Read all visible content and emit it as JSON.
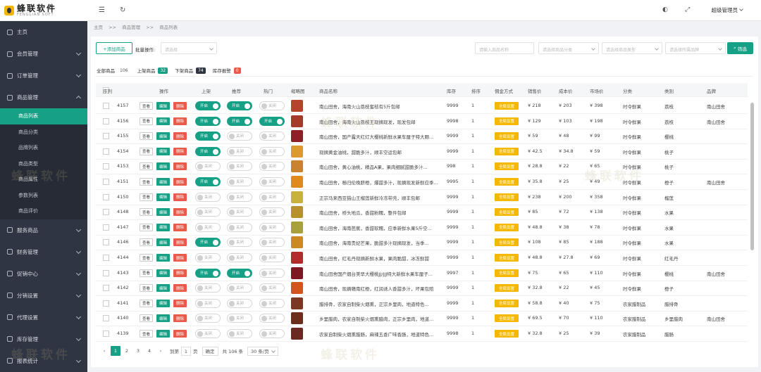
{
  "logo": {
    "cn": "蜂联软件",
    "en": "FENGLIAN SOFT"
  },
  "sidebar": {
    "groups": [
      {
        "label": "主页"
      },
      {
        "label": "会员管理"
      },
      {
        "label": "订单管理"
      },
      {
        "label": "商品管理"
      },
      {
        "label": "服务商品"
      },
      {
        "label": "财务管理"
      },
      {
        "label": "促销中心"
      },
      {
        "label": "分销设置"
      },
      {
        "label": "代理设置"
      },
      {
        "label": "库存管理"
      },
      {
        "label": "报表统计"
      }
    ],
    "sub": [
      "商品列表",
      "商品分类",
      "品牌列表",
      "商品类型",
      "商品属性",
      "参数列表",
      "商品评价"
    ]
  },
  "topbar": {
    "menu_icon": "menu-icon",
    "refresh_icon": "refresh-icon",
    "user": "超级管理员"
  },
  "breadcrumb": [
    "主页",
    ">>",
    "商品管理",
    ">>",
    "商品列表"
  ],
  "toolbar": {
    "add": "+添加商品",
    "bulk_label": "批量操作:",
    "bulk_placeholder": "请选择",
    "search_placeholder": "请输入商品名称",
    "category_placeholder": "请选择商品分类",
    "type_placeholder": "请选择商品类型",
    "brand_placeholder": "请选择所属品牌",
    "filter": "筛选"
  },
  "tabs": [
    {
      "label": "全部商品",
      "count": "106",
      "color": "none"
    },
    {
      "label": "上架商品",
      "count": "32",
      "color": "#16a085"
    },
    {
      "label": "下架商品",
      "count": "74",
      "color": "#2f3542"
    },
    {
      "label": "库存报警",
      "count": "0",
      "color": "#ea5a4b"
    }
  ],
  "columns": [
    "序列",
    "操作",
    "上架",
    "推荐",
    "热门",
    "缩略图",
    "商品名称",
    "库存",
    "排序",
    "佣金方式",
    "销售价",
    "成本价",
    "市场价",
    "分类",
    "类别",
    "品牌"
  ],
  "ops": {
    "view": "查看",
    "edit": "编辑",
    "del": "删除"
  },
  "switch": {
    "on": "开启",
    "off": "关闭"
  },
  "commission_tag": "全局设置",
  "colors": {
    "accent": "#16a085",
    "danger": "#ea5a4b",
    "warning": "#f5b800",
    "sidebar": "#2f3542"
  },
  "rows": [
    {
      "id": "4157",
      "up": true,
      "rec": true,
      "hot": false,
      "name": "南山田舍，海南火山荔枝蜜桔有5斤包邮",
      "stock": "9999",
      "sort": "1",
      "price": "¥ 218",
      "cost": "¥ 203",
      "market": "¥ 398",
      "cat": "时令鲜果",
      "kind": "荔枝",
      "brand": "南山田舍",
      "thumb": "#b5442c"
    },
    {
      "id": "4156",
      "up": true,
      "rec": true,
      "hot": true,
      "name": "南山田舍，海南火山荔枝王现摘现发，现发包邮",
      "stock": "9998",
      "sort": "1",
      "price": "¥ 129",
      "cost": "¥ 103",
      "market": "¥ 198",
      "cat": "时令鲜果",
      "kind": "荔枝",
      "brand": "南山田舍",
      "thumb": "#a63a2a"
    },
    {
      "id": "4155",
      "up": true,
      "rec": false,
      "hot": false,
      "name": "南山田舍，国产露天红灯大樱桃新鲜水果车厘子特大颗...",
      "stock": "9999",
      "sort": "1",
      "price": "¥ 59",
      "cost": "¥ 48",
      "market": "¥ 99",
      "cat": "时令鲜果",
      "kind": "樱桃",
      "brand": "",
      "thumb": "#8e1f26"
    },
    {
      "id": "4154",
      "up": true,
      "rec": false,
      "hot": false,
      "name": "现摘黄金油桃，甜脆多汁，顺丰空运包邮",
      "stock": "9999",
      "sort": "1",
      "price": "¥ 42.5",
      "cost": "¥ 34.8",
      "market": "¥ 59",
      "cat": "时令鲜果",
      "kind": "桃子",
      "brand": "",
      "thumb": "#d99b2b"
    },
    {
      "id": "4153",
      "up": false,
      "rec": false,
      "hot": false,
      "name": "南山田舍，黄心油桃，精品A果，果肉细腻甜脆多汁...",
      "stock": "998",
      "sort": "1",
      "price": "¥ 28.8",
      "cost": "¥ 22",
      "market": "¥ 65",
      "cat": "时令鲜果",
      "kind": "桃子",
      "brand": "",
      "thumb": "#c9832e"
    },
    {
      "id": "4151",
      "up": true,
      "rec": false,
      "hot": false,
      "name": "南山田舍，秭归伦晚脐橙，爆甜多汁，现摘现发新鲜应季...",
      "stock": "9995",
      "sort": "1",
      "price": "¥ 35.8",
      "cost": "¥ 25",
      "market": "¥ 49",
      "cat": "时令鲜果",
      "kind": "橙子",
      "brand": "南山田舍",
      "thumb": "#e08a1e"
    },
    {
      "id": "4150",
      "up": false,
      "rec": false,
      "hot": false,
      "name": "正宗马来西亚猫山王榴莲新鲜冷冻带壳，顺丰包邮",
      "stock": "9999",
      "sort": "1",
      "price": "¥ 238",
      "cost": "¥ 200",
      "market": "¥ 358",
      "cat": "时令鲜果",
      "kind": "榴莲",
      "brand": "",
      "thumb": "#c7b33a"
    },
    {
      "id": "4148",
      "up": false,
      "rec": false,
      "hot": false,
      "name": "南山田舍，桥头地瓜，香甜粉糯，整件包邮",
      "stock": "9999",
      "sort": "1",
      "price": "¥ 85",
      "cost": "¥ 72",
      "market": "¥ 138",
      "cat": "时令鲜果",
      "kind": "水果",
      "brand": "",
      "thumb": "#b7922c"
    },
    {
      "id": "4147",
      "up": false,
      "rec": false,
      "hot": false,
      "name": "南山田舍，海南芭蕉，香甜软糯，应季新鲜水果5斤空...",
      "stock": "9999",
      "sort": "1",
      "price": "¥ 48.8",
      "cost": "¥ 38",
      "market": "¥ 78",
      "cat": "时令鲜果",
      "kind": "水果",
      "brand": "",
      "thumb": "#a8a03a"
    },
    {
      "id": "4146",
      "up": true,
      "rec": false,
      "hot": false,
      "name": "南山田舍，海南贵妃芒果，脆甜多汁现摘现发，当季...",
      "stock": "9999",
      "sort": "1",
      "price": "¥ 108",
      "cost": "¥ 85",
      "market": "¥ 188",
      "cat": "时令鲜果",
      "kind": "水果",
      "brand": "",
      "thumb": "#c98a1f"
    },
    {
      "id": "4144",
      "up": false,
      "rec": false,
      "hot": false,
      "name": "南山田舍，红毛丹现摘新鲜水果，果肉脆甜，冰冻鲜甜",
      "stock": "9999",
      "sort": "1",
      "price": "¥ 48.8",
      "cost": "¥ 27.8",
      "market": "¥ 69",
      "cat": "时令鲜果",
      "kind": "红毛丹",
      "brand": "",
      "thumb": "#b42d2d"
    },
    {
      "id": "4143",
      "up": true,
      "rec": true,
      "hot": false,
      "name": "南山田舍国产烟台美早大樱桃JJ/JJJ特大新鲜水果车厘子...",
      "stock": "9997",
      "sort": "1",
      "price": "¥ 75",
      "cost": "¥ 65",
      "market": "¥ 110",
      "cat": "时令鲜果",
      "kind": "樱桃",
      "brand": "南山田舍",
      "thumb": "#7e1722"
    },
    {
      "id": "4142",
      "up": false,
      "rec": false,
      "hot": false,
      "name": "南山田舍，现摘赣南红橙，红润诱人香甜多汁，坏果包赔",
      "stock": "9999",
      "sort": "1",
      "price": "¥ 32.8",
      "cost": "¥ 22",
      "market": "¥ 45",
      "cat": "时令鲜果",
      "kind": "橙子",
      "brand": "",
      "thumb": "#d4541f"
    },
    {
      "id": "4141",
      "up": false,
      "rec": false,
      "hot": false,
      "name": "腊排骨，农家自制柴火烟熏，正宗乡里肉，地道特色...",
      "stock": "9999",
      "sort": "1",
      "price": "¥ 58.8",
      "cost": "¥ 40",
      "market": "¥ 75",
      "cat": "农家腊制品",
      "kind": "腊排骨",
      "brand": "",
      "thumb": "#7a3a22"
    },
    {
      "id": "4140",
      "up": false,
      "rec": false,
      "hot": false,
      "name": "乡里腊肉，农家自制柴火烟熏腊肉，正宗乡里肉，地道...",
      "stock": "9999",
      "sort": "1",
      "price": "¥ 69.5",
      "cost": "¥ 70",
      "market": "¥ 110",
      "cat": "农家腊制品",
      "kind": "乡里腊肉",
      "brand": "南山田舍",
      "thumb": "#6e2e1c"
    },
    {
      "id": "4139",
      "up": false,
      "rec": false,
      "hot": false,
      "name": "农家自制柴火烟熏腊肠，麻辣五香广味香肠，地道特色...",
      "stock": "9998",
      "sort": "1",
      "price": "¥ 32.8",
      "cost": "¥ 25",
      "market": "¥ 39",
      "cat": "农家腊制品",
      "kind": "腊肠",
      "brand": "",
      "thumb": "#6a2a22"
    }
  ],
  "pager": {
    "pages": [
      "1",
      "2",
      "3",
      "4"
    ],
    "goto": "到第",
    "page_input": "1",
    "page_unit": "页",
    "confirm": "确定",
    "total": "共 106 条",
    "size": "30 条/页"
  },
  "watermark": "蜂联软件"
}
